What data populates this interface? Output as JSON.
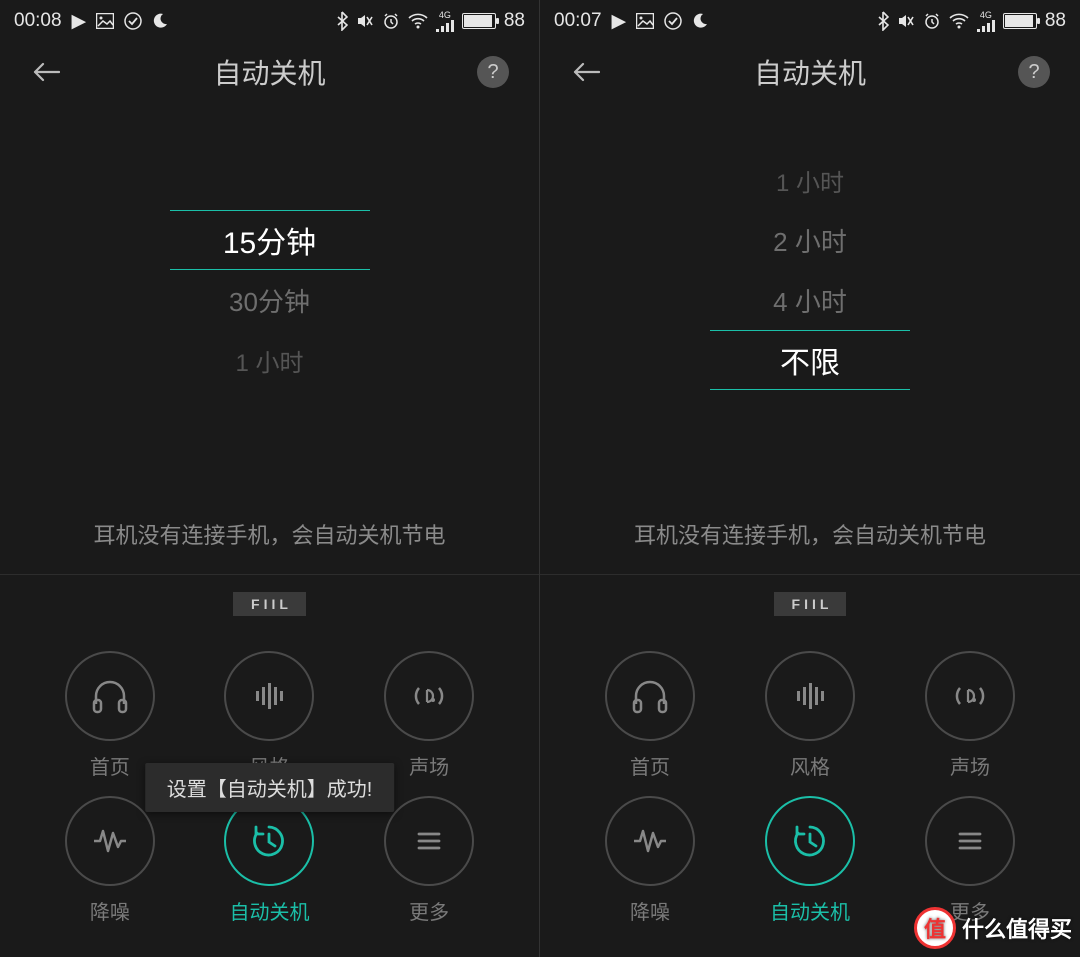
{
  "screens": [
    {
      "status": {
        "time": "00:08",
        "battery_pct": "88",
        "network": "4G"
      },
      "header": {
        "title": "自动关机",
        "help": "?"
      },
      "picker": {
        "items_before": [],
        "selected": "15分钟",
        "items_after": [
          "30分钟",
          "1 小时"
        ]
      },
      "hint": "耳机没有连接手机，会自动关机节电",
      "brand": "FIIL",
      "grid": [
        {
          "label": "首页",
          "icon": "headphones",
          "active": false
        },
        {
          "label": "风格",
          "icon": "equalizer",
          "active": false
        },
        {
          "label": "声场",
          "icon": "surround",
          "active": false
        },
        {
          "label": "降噪",
          "icon": "wave",
          "active": false
        },
        {
          "label": "自动关机",
          "icon": "clock",
          "active": true
        },
        {
          "label": "更多",
          "icon": "menu",
          "active": false
        }
      ],
      "toast": "设置【自动关机】成功!"
    },
    {
      "status": {
        "time": "00:07",
        "battery_pct": "88",
        "network": "4G"
      },
      "header": {
        "title": "自动关机",
        "help": "?"
      },
      "picker": {
        "items_before": [
          "1 小时",
          "2 小时",
          "4 小时"
        ],
        "selected": "不限",
        "items_after": []
      },
      "hint": "耳机没有连接手机，会自动关机节电",
      "brand": "FIIL",
      "grid": [
        {
          "label": "首页",
          "icon": "headphones",
          "active": false
        },
        {
          "label": "风格",
          "icon": "equalizer",
          "active": false
        },
        {
          "label": "声场",
          "icon": "surround",
          "active": false
        },
        {
          "label": "降噪",
          "icon": "wave",
          "active": false
        },
        {
          "label": "自动关机",
          "icon": "clock",
          "active": true
        },
        {
          "label": "更多",
          "icon": "menu",
          "active": false
        }
      ],
      "toast": null
    }
  ],
  "watermark": {
    "badge": "值",
    "text": "什么值得买"
  }
}
